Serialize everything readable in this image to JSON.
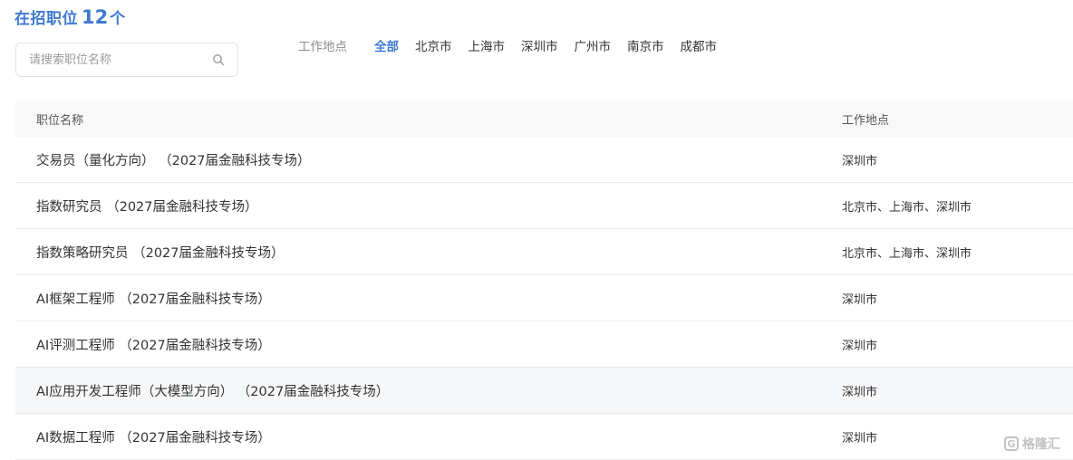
{
  "header": {
    "label": "在招职位",
    "count": "12",
    "unit": "个"
  },
  "search": {
    "placeholder": "请搜索职位名称",
    "icon": "search-icon"
  },
  "filter": {
    "label": "工作地点",
    "options": [
      "全部",
      "北京市",
      "上海市",
      "深圳市",
      "广州市",
      "南京市",
      "成都市"
    ],
    "active": "全部",
    "active_color": "#3e7ad1"
  },
  "table": {
    "columns": [
      "职位名称",
      "工作地点"
    ],
    "rows": [
      {
        "title": "交易员（量化方向） （2027届金融科技专场）",
        "location": "深圳市"
      },
      {
        "title": "指数研究员 （2027届金融科技专场）",
        "location": "北京市、上海市、深圳市"
      },
      {
        "title": "指数策略研究员 （2027届金融科技专场）",
        "location": "北京市、上海市、深圳市"
      },
      {
        "title": "AI框架工程师 （2027届金融科技专场）",
        "location": "深圳市"
      },
      {
        "title": "AI评测工程师 （2027届金融科技专场）",
        "location": "深圳市"
      },
      {
        "title": "AI应用开发工程师（大模型方向） （2027届金融科技专场）",
        "location": "深圳市"
      },
      {
        "title": "AI数据工程师 （2027届金融科技专场）",
        "location": "深圳市"
      }
    ]
  },
  "watermark": {
    "text": "格隆汇",
    "glyph": "G"
  }
}
